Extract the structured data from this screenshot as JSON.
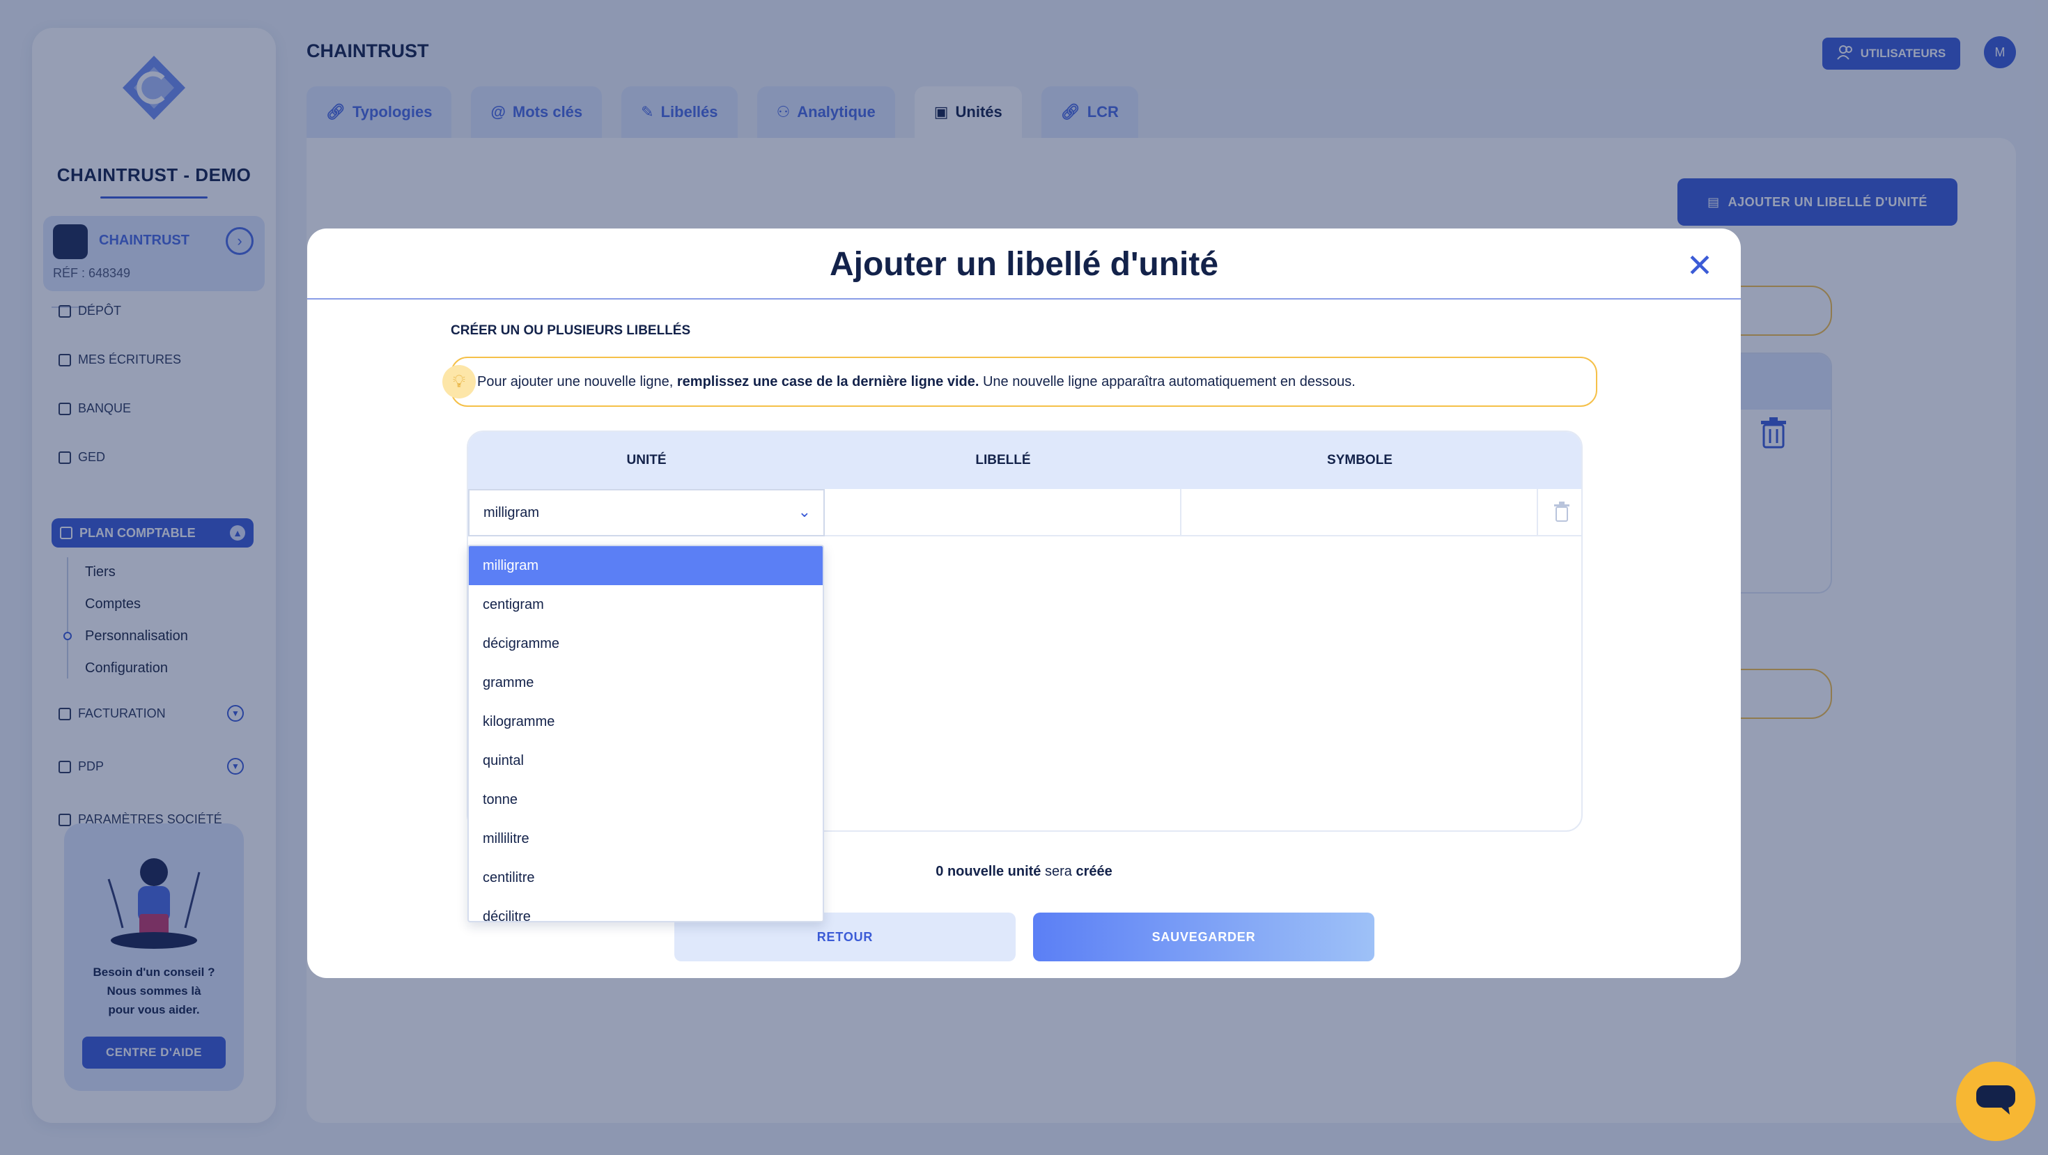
{
  "sidebar": {
    "company_name": "CHAINTRUST - DEMO",
    "card": {
      "name": "CHAINTRUST",
      "ref": "RÉF : 648349"
    },
    "nav": [
      {
        "label": "DÉPÔT",
        "icon": "folder-icon"
      },
      {
        "label": "MES ÉCRITURES",
        "icon": "folder-icon"
      },
      {
        "label": "BANQUE",
        "icon": "bank-icon"
      },
      {
        "label": "GED",
        "icon": "document-icon"
      }
    ],
    "active_section": {
      "label": "PLAN COMPTABLE",
      "icon": "ledger-icon"
    },
    "subnav": [
      "Tiers",
      "Comptes",
      "Personnalisation",
      "Configuration"
    ],
    "nav_bottom": [
      {
        "label": "FACTURATION",
        "icon": "invoice-icon"
      },
      {
        "label": "PDP",
        "icon": "card-icon"
      },
      {
        "label": "PARAMÈTRES SOCIÉTÉ",
        "icon": "sliders-icon"
      }
    ],
    "help": {
      "text_line1": "Besoin d'un conseil ?",
      "text_line2": "Nous sommes là",
      "text_line3": "pour vous aider.",
      "button": "CENTRE D'AIDE"
    }
  },
  "header": {
    "title": "CHAINTRUST",
    "users_button": "UTILISATEURS",
    "avatar_initial": "M"
  },
  "tabs": [
    {
      "label": "Typologies",
      "icon": "link-icon",
      "active": false
    },
    {
      "label": "Mots clés",
      "icon": "at-icon",
      "active": false
    },
    {
      "label": "Libellés",
      "icon": "pen-icon",
      "active": false
    },
    {
      "label": "Analytique",
      "icon": "users-icon",
      "active": false
    },
    {
      "label": "Unités",
      "icon": "unit-icon",
      "active": true
    },
    {
      "label": "LCR",
      "icon": "link-icon",
      "active": false
    }
  ],
  "main": {
    "add_button": "AJOUTER UN LIBELLÉ D'UNITÉ"
  },
  "modal": {
    "title": "Ajouter un libellé d'unité",
    "section_label": "CRÉER UN OU PLUSIEURS LIBELLÉS",
    "tip": {
      "prefix": "Pour ajouter une nouvelle ligne, ",
      "bold": "remplissez une case de la dernière ligne vide.",
      "suffix": " Une nouvelle ligne apparaîtra automatiquement en dessous."
    },
    "columns": [
      "UNITÉ",
      "LIBELLÉ",
      "SYMBOLE"
    ],
    "row": {
      "unit_value": "milligram",
      "label_value": "",
      "symbol_value": ""
    },
    "dropdown_options": [
      "milligram",
      "centigram",
      "décigramme",
      "gramme",
      "kilogramme",
      "quintal",
      "tonne",
      "millilitre",
      "centilitre",
      "décilitre"
    ],
    "dropdown_selected": "milligram",
    "summary": {
      "count_text": "0 nouvelle unité",
      "middle": " sera ",
      "end": "créée"
    },
    "back_button": "RETOUR",
    "save_button": "SAUVEGARDER"
  },
  "colors": {
    "accent": "#3b5bd6",
    "highlight": "#5b7ff5",
    "warning_border": "#f5c048",
    "chat": "#f7b733"
  }
}
